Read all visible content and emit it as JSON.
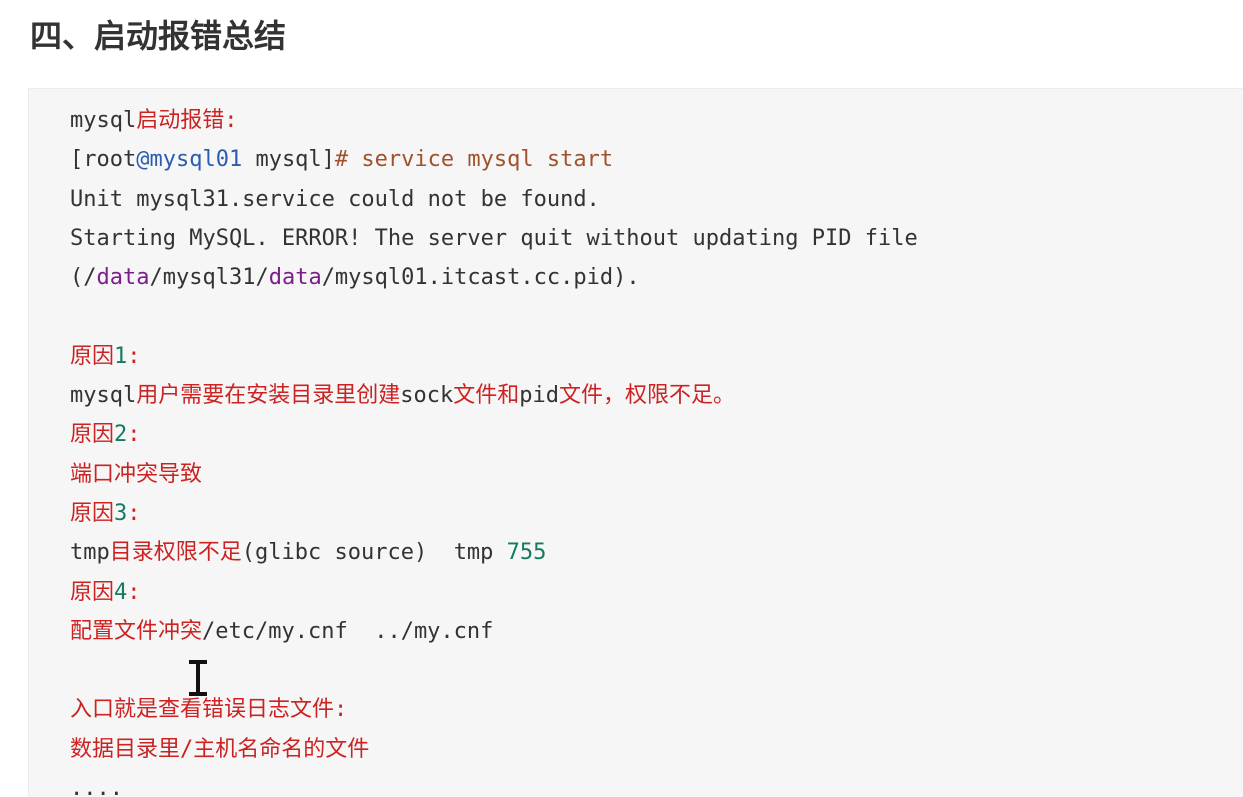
{
  "heading": "四、启动报错总结",
  "code_lines": [
    [
      {
        "t": "mysql",
        "c": "plain"
      },
      {
        "t": "启动报错:",
        "c": "red"
      }
    ],
    [
      {
        "t": "[root",
        "c": "plain"
      },
      {
        "t": "@mysql01",
        "c": "blue"
      },
      {
        "t": " mysql]",
        "c": "plain"
      },
      {
        "t": "# service mysql start",
        "c": "brown"
      }
    ],
    [
      {
        "t": "Unit mysql31.service could not be found.",
        "c": "plain"
      }
    ],
    [
      {
        "t": "Starting MySQL. ERROR! The server quit without updating PID file",
        "c": "plain"
      }
    ],
    [
      {
        "t": "(/",
        "c": "plain"
      },
      {
        "t": "data",
        "c": "purple"
      },
      {
        "t": "/mysql31/",
        "c": "plain"
      },
      {
        "t": "data",
        "c": "purple"
      },
      {
        "t": "/mysql01.itcast.cc.pid).",
        "c": "plain"
      }
    ],
    [],
    [
      {
        "t": "原因",
        "c": "red"
      },
      {
        "t": "1",
        "c": "green"
      },
      {
        "t": ":",
        "c": "red"
      }
    ],
    [
      {
        "t": "mysql",
        "c": "plain"
      },
      {
        "t": "用户需要在安装目录里创建",
        "c": "red"
      },
      {
        "t": "sock",
        "c": "plain"
      },
      {
        "t": "文件和",
        "c": "red"
      },
      {
        "t": "pid",
        "c": "plain"
      },
      {
        "t": "文件，权限不足。",
        "c": "red"
      }
    ],
    [
      {
        "t": "原因",
        "c": "red"
      },
      {
        "t": "2",
        "c": "green"
      },
      {
        "t": ":",
        "c": "red"
      }
    ],
    [
      {
        "t": "端口冲突导致",
        "c": "red"
      }
    ],
    [
      {
        "t": "原因",
        "c": "red"
      },
      {
        "t": "3",
        "c": "green"
      },
      {
        "t": ":",
        "c": "red"
      }
    ],
    [
      {
        "t": "tmp",
        "c": "plain"
      },
      {
        "t": "目录权限不足",
        "c": "red"
      },
      {
        "t": "(glibc source)  tmp ",
        "c": "plain"
      },
      {
        "t": "755",
        "c": "green"
      }
    ],
    [
      {
        "t": "原因",
        "c": "red"
      },
      {
        "t": "4",
        "c": "green"
      },
      {
        "t": ":",
        "c": "red"
      }
    ],
    [
      {
        "t": "配置文件冲突",
        "c": "red"
      },
      {
        "t": "/etc/my.cnf  ../my.cnf",
        "c": "plain"
      }
    ],
    [],
    [
      {
        "t": "入口就是查看错误日志文件:",
        "c": "red"
      }
    ],
    [
      {
        "t": "数据目录里/主机名命名的文件",
        "c": "red"
      }
    ],
    [
      {
        "t": "....",
        "c": "plain"
      }
    ]
  ],
  "icons": {
    "cursor": "text-cursor-icon"
  }
}
